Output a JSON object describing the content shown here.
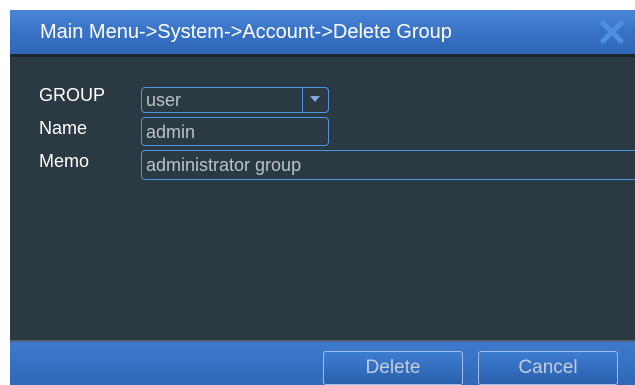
{
  "dialog": {
    "title": "Main Menu->System->Account->Delete Group",
    "close_icon": "close-icon"
  },
  "form": {
    "group_label": "GROUP",
    "group_value": "user",
    "name_label": "Name",
    "name_value": "admin",
    "memo_label": "Memo",
    "memo_value": "administrator group"
  },
  "footer": {
    "delete_label": "Delete",
    "cancel_label": "Cancel"
  },
  "colors": {
    "titlebar": "#3a74c6",
    "panel": "#2b3943",
    "field_border": "#4b97e2"
  }
}
